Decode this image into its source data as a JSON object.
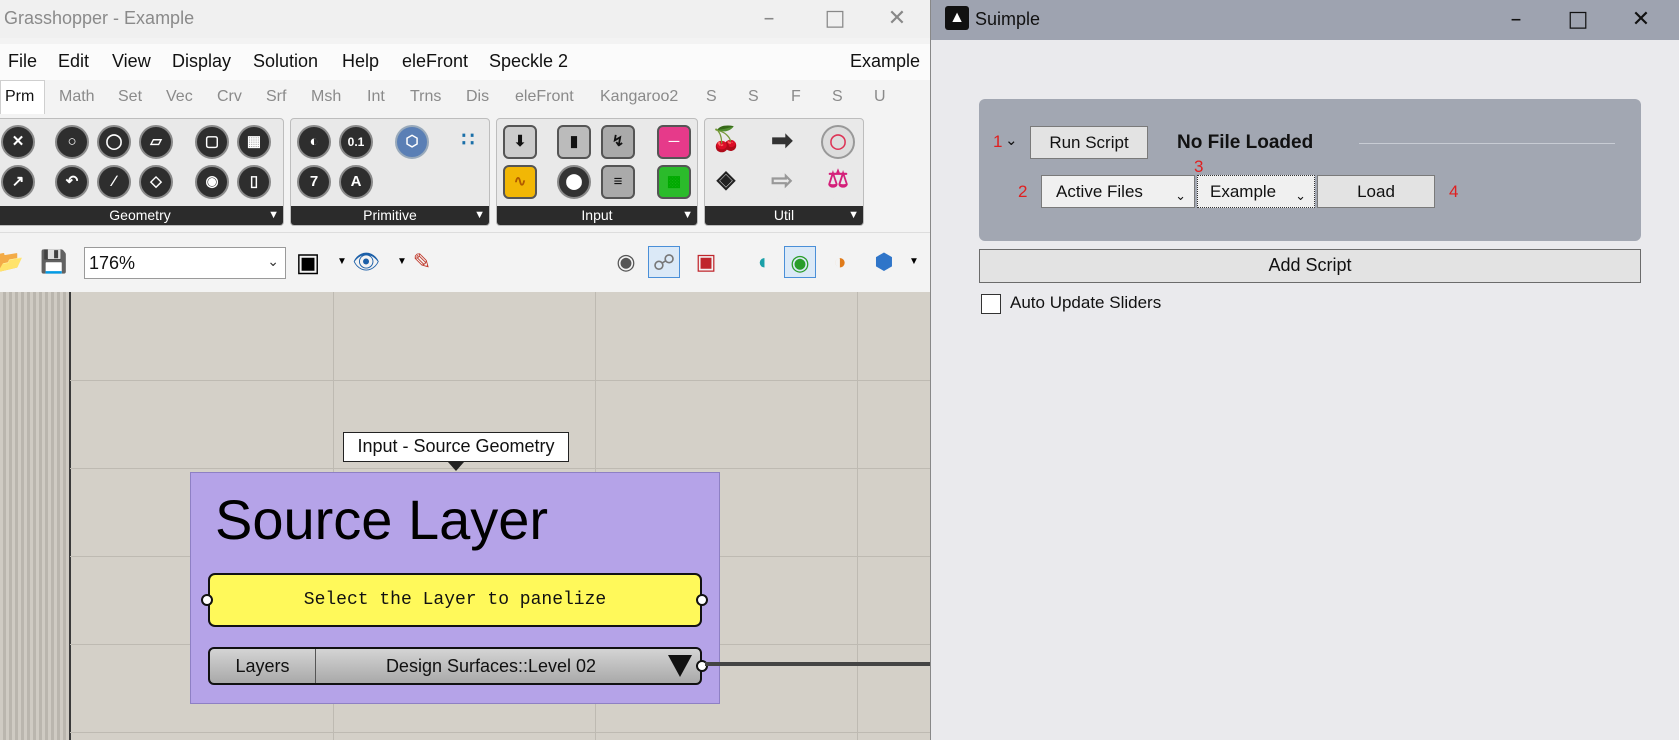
{
  "grasshopper": {
    "title": "Grasshopper - Example",
    "menu": [
      "File",
      "Edit",
      "View",
      "Display",
      "Solution",
      "Help",
      "eleFront",
      "Speckle 2"
    ],
    "document_name": "Example",
    "tabs": [
      "Prm",
      "Math",
      "Set",
      "Vec",
      "Crv",
      "Srf",
      "Msh",
      "Int",
      "Trns",
      "Dis",
      "eleFront",
      "Kangaroo2",
      "S",
      "S",
      "F",
      "S",
      "U"
    ],
    "active_tab": "Prm",
    "panels": [
      "Geometry",
      "Primitive",
      "Input",
      "Util"
    ],
    "primitive_icon_labels": [
      "0.1",
      "7",
      "A"
    ],
    "zoom": "176%",
    "canvas": {
      "tooltip": "Input - Source Geometry",
      "group_title": "Source Layer",
      "panel_text": "Select the Layer to panelize",
      "value_list_label": "Layers",
      "value_list_value": "Design Surfaces::Level 02"
    }
  },
  "suimple": {
    "title": "Suimple",
    "markers": [
      "1",
      "2",
      "3",
      "4"
    ],
    "run_script_label": "Run Script",
    "status": "No File Loaded",
    "files_select": "Active Files",
    "doc_select": "Example",
    "load_label": "Load",
    "add_script_label": "Add Script",
    "auto_update_label": "Auto Update Sliders",
    "auto_update_checked": false
  },
  "colors": {
    "group_fill": "#b5a3e8",
    "panel_yellow": "#fff95a",
    "suimple_titlebar": "#9ea3b0",
    "marker_red": "#e02020"
  }
}
